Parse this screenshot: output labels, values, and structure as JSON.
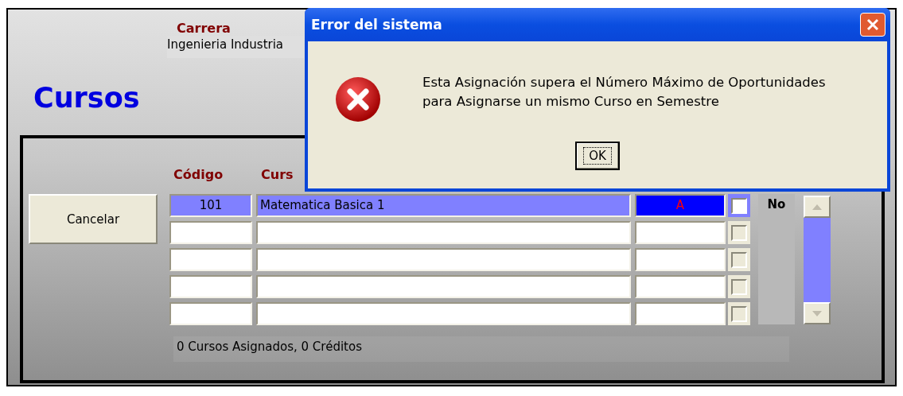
{
  "header": {
    "career_label": "Carrera",
    "career_value": "Ingenieria Industria",
    "title": "Cursos"
  },
  "cancel_button": "Cancelar",
  "table": {
    "columns": [
      "Código",
      "Curs"
    ],
    "rows": [
      {
        "code": "101",
        "course": "Matematica Basica 1",
        "column_3": "A",
        "selected": true,
        "checked": false
      },
      {
        "selected": false,
        "checked": false
      },
      {
        "selected": false,
        "checked": false
      },
      {
        "selected": false,
        "checked": false
      },
      {
        "selected": false,
        "checked": false
      }
    ]
  },
  "side_label": "No",
  "summary": "0 Cursos Asignados, 0 Créditos",
  "dialog": {
    "title": "Error del sistema",
    "kind": "error",
    "message_lines": [
      "Esta Asignación supera el Número Máximo de Oportunidades",
      "para Asignarse un mismo Curso en Semestre"
    ],
    "button": "OK"
  }
}
